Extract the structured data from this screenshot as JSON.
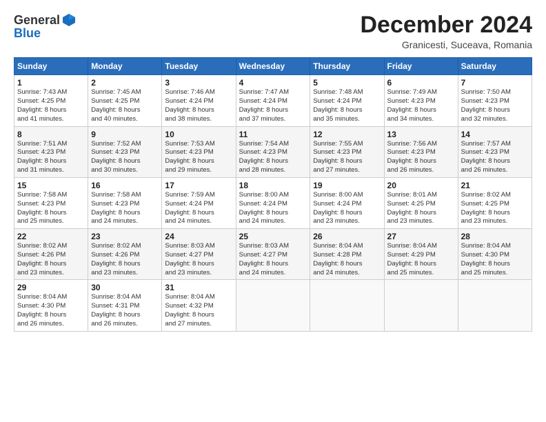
{
  "logo": {
    "general": "General",
    "blue": "Blue"
  },
  "title": "December 2024",
  "location": "Granicesti, Suceava, Romania",
  "days_of_week": [
    "Sunday",
    "Monday",
    "Tuesday",
    "Wednesday",
    "Thursday",
    "Friday",
    "Saturday"
  ],
  "weeks": [
    [
      {
        "day": "1",
        "info": "Sunrise: 7:43 AM\nSunset: 4:25 PM\nDaylight: 8 hours\nand 41 minutes."
      },
      {
        "day": "2",
        "info": "Sunrise: 7:45 AM\nSunset: 4:25 PM\nDaylight: 8 hours\nand 40 minutes."
      },
      {
        "day": "3",
        "info": "Sunrise: 7:46 AM\nSunset: 4:24 PM\nDaylight: 8 hours\nand 38 minutes."
      },
      {
        "day": "4",
        "info": "Sunrise: 7:47 AM\nSunset: 4:24 PM\nDaylight: 8 hours\nand 37 minutes."
      },
      {
        "day": "5",
        "info": "Sunrise: 7:48 AM\nSunset: 4:24 PM\nDaylight: 8 hours\nand 35 minutes."
      },
      {
        "day": "6",
        "info": "Sunrise: 7:49 AM\nSunset: 4:23 PM\nDaylight: 8 hours\nand 34 minutes."
      },
      {
        "day": "7",
        "info": "Sunrise: 7:50 AM\nSunset: 4:23 PM\nDaylight: 8 hours\nand 32 minutes."
      }
    ],
    [
      {
        "day": "8",
        "info": "Sunrise: 7:51 AM\nSunset: 4:23 PM\nDaylight: 8 hours\nand 31 minutes."
      },
      {
        "day": "9",
        "info": "Sunrise: 7:52 AM\nSunset: 4:23 PM\nDaylight: 8 hours\nand 30 minutes."
      },
      {
        "day": "10",
        "info": "Sunrise: 7:53 AM\nSunset: 4:23 PM\nDaylight: 8 hours\nand 29 minutes."
      },
      {
        "day": "11",
        "info": "Sunrise: 7:54 AM\nSunset: 4:23 PM\nDaylight: 8 hours\nand 28 minutes."
      },
      {
        "day": "12",
        "info": "Sunrise: 7:55 AM\nSunset: 4:23 PM\nDaylight: 8 hours\nand 27 minutes."
      },
      {
        "day": "13",
        "info": "Sunrise: 7:56 AM\nSunset: 4:23 PM\nDaylight: 8 hours\nand 26 minutes."
      },
      {
        "day": "14",
        "info": "Sunrise: 7:57 AM\nSunset: 4:23 PM\nDaylight: 8 hours\nand 26 minutes."
      }
    ],
    [
      {
        "day": "15",
        "info": "Sunrise: 7:58 AM\nSunset: 4:23 PM\nDaylight: 8 hours\nand 25 minutes."
      },
      {
        "day": "16",
        "info": "Sunrise: 7:58 AM\nSunset: 4:23 PM\nDaylight: 8 hours\nand 24 minutes."
      },
      {
        "day": "17",
        "info": "Sunrise: 7:59 AM\nSunset: 4:24 PM\nDaylight: 8 hours\nand 24 minutes."
      },
      {
        "day": "18",
        "info": "Sunrise: 8:00 AM\nSunset: 4:24 PM\nDaylight: 8 hours\nand 24 minutes."
      },
      {
        "day": "19",
        "info": "Sunrise: 8:00 AM\nSunset: 4:24 PM\nDaylight: 8 hours\nand 23 minutes."
      },
      {
        "day": "20",
        "info": "Sunrise: 8:01 AM\nSunset: 4:25 PM\nDaylight: 8 hours\nand 23 minutes."
      },
      {
        "day": "21",
        "info": "Sunrise: 8:02 AM\nSunset: 4:25 PM\nDaylight: 8 hours\nand 23 minutes."
      }
    ],
    [
      {
        "day": "22",
        "info": "Sunrise: 8:02 AM\nSunset: 4:26 PM\nDaylight: 8 hours\nand 23 minutes."
      },
      {
        "day": "23",
        "info": "Sunrise: 8:02 AM\nSunset: 4:26 PM\nDaylight: 8 hours\nand 23 minutes."
      },
      {
        "day": "24",
        "info": "Sunrise: 8:03 AM\nSunset: 4:27 PM\nDaylight: 8 hours\nand 23 minutes."
      },
      {
        "day": "25",
        "info": "Sunrise: 8:03 AM\nSunset: 4:27 PM\nDaylight: 8 hours\nand 24 minutes."
      },
      {
        "day": "26",
        "info": "Sunrise: 8:04 AM\nSunset: 4:28 PM\nDaylight: 8 hours\nand 24 minutes."
      },
      {
        "day": "27",
        "info": "Sunrise: 8:04 AM\nSunset: 4:29 PM\nDaylight: 8 hours\nand 25 minutes."
      },
      {
        "day": "28",
        "info": "Sunrise: 8:04 AM\nSunset: 4:30 PM\nDaylight: 8 hours\nand 25 minutes."
      }
    ],
    [
      {
        "day": "29",
        "info": "Sunrise: 8:04 AM\nSunset: 4:30 PM\nDaylight: 8 hours\nand 26 minutes."
      },
      {
        "day": "30",
        "info": "Sunrise: 8:04 AM\nSunset: 4:31 PM\nDaylight: 8 hours\nand 26 minutes."
      },
      {
        "day": "31",
        "info": "Sunrise: 8:04 AM\nSunset: 4:32 PM\nDaylight: 8 hours\nand 27 minutes."
      },
      {
        "day": "",
        "info": ""
      },
      {
        "day": "",
        "info": ""
      },
      {
        "day": "",
        "info": ""
      },
      {
        "day": "",
        "info": ""
      }
    ]
  ]
}
